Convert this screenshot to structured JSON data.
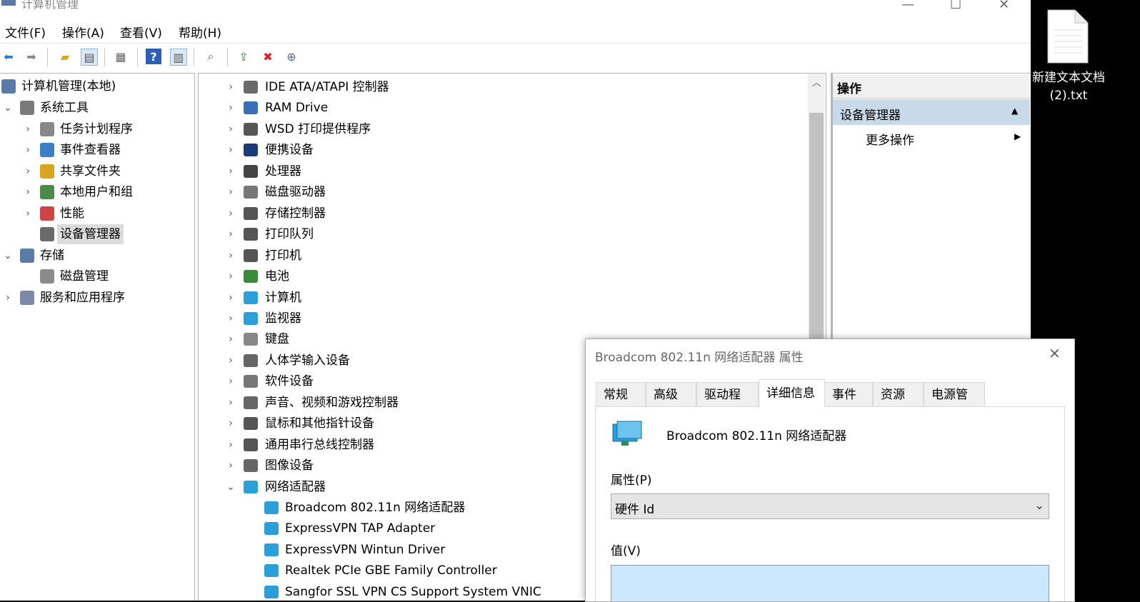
{
  "window": {
    "title": "计算机管理",
    "menu": [
      "文件(F)",
      "操作(A)",
      "查看(V)",
      "帮助(H)"
    ],
    "controls": [
      "—",
      "☐",
      "✕"
    ]
  },
  "toolbar": {
    "icons": [
      "back-arrow-icon",
      "forward-arrow-icon",
      "up-folder-icon",
      "show-tree-icon",
      "properties-icon",
      "help-icon",
      "action-pane-icon",
      "scan-hardware-icon",
      "update-driver-icon",
      "disable-device-icon",
      "uninstall-device-icon"
    ]
  },
  "left_tree": {
    "root": "计算机管理(本地)",
    "items": [
      {
        "label": "系统工具",
        "level": 1,
        "chevron": "⌄"
      },
      {
        "label": "任务计划程序",
        "level": 2,
        "chevron": "›"
      },
      {
        "label": "事件查看器",
        "level": 2,
        "chevron": "›"
      },
      {
        "label": "共享文件夹",
        "level": 2,
        "chevron": "›"
      },
      {
        "label": "本地用户和组",
        "level": 2,
        "chevron": "›"
      },
      {
        "label": "性能",
        "level": 2,
        "chevron": "›"
      },
      {
        "label": "设备管理器",
        "level": 2,
        "chevron": "",
        "selected": true
      },
      {
        "label": "存储",
        "level": 1,
        "chevron": "⌄"
      },
      {
        "label": "磁盘管理",
        "level": 2,
        "chevron": ""
      },
      {
        "label": "服务和应用程序",
        "level": 1,
        "chevron": "›"
      }
    ]
  },
  "device_tree": {
    "categories": [
      "IDE ATA/ATAPI 控制器",
      "RAM Drive",
      "WSD 打印提供程序",
      "便携设备",
      "处理器",
      "磁盘驱动器",
      "存储控制器",
      "打印队列",
      "打印机",
      "电池",
      "计算机",
      "监视器",
      "键盘",
      "人体学输入设备",
      "软件设备",
      "声音、视频和游戏控制器",
      "鼠标和其他指针设备",
      "通用串行总线控制器",
      "图像设备",
      "网络适配器"
    ],
    "expanded_children": [
      "Broadcom 802.11n 网络适配器",
      "ExpressVPN TAP Adapter",
      "ExpressVPN Wintun Driver",
      "Realtek PCIe GBE Family Controller",
      "Sangfor SSL VPN CS Support System VNIC"
    ]
  },
  "actions_pane": {
    "header": "操作",
    "section": "设备管理器",
    "item": "更多操作"
  },
  "desktop": {
    "file_label_line1": "新建文本文档",
    "file_label_line2": "(2).txt"
  },
  "dialog": {
    "title": "Broadcom 802.11n 网络适配器 属性",
    "tabs": [
      "常规",
      "高级",
      "驱动程序",
      "详细信息",
      "事件",
      "资源",
      "电源管理"
    ],
    "active_tab": "详细信息",
    "device_name": "Broadcom 802.11n 网络适配器",
    "property_label": "属性(P)",
    "property_value": "硬件 Id",
    "value_label": "值(V)"
  },
  "colors": {
    "selection": "#dcdcdc",
    "actions_header": "#c8d9ea",
    "value_box": "#cce8ff"
  }
}
